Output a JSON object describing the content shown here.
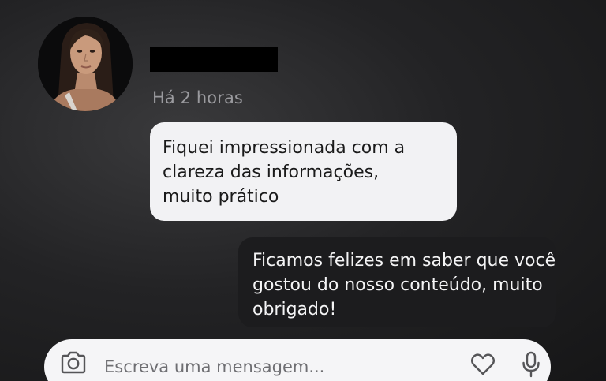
{
  "contact": {
    "avatar_icon": "profile-photo",
    "timestamp": "Há 2 horas"
  },
  "messages": [
    {
      "direction": "incoming",
      "lines": [
        "Fiquei impressionada com a",
        "clareza das informações,",
        "muito prático"
      ]
    },
    {
      "direction": "outgoing",
      "lines": [
        "Ficamos felizes em saber que você",
        "gostou do nosso conteúdo, muito",
        "obrigado!"
      ]
    }
  ],
  "composer": {
    "placeholder": "Escreva uma mensagem...",
    "camera_icon": "camera-icon",
    "heart_icon": "heart-icon",
    "mic_icon": "microphone-icon"
  },
  "colors": {
    "incoming_bubble": "#f2f2f4",
    "outgoing_bubble": "#1c1c1e",
    "background": "#232325",
    "composer": "#f5f5f7"
  }
}
